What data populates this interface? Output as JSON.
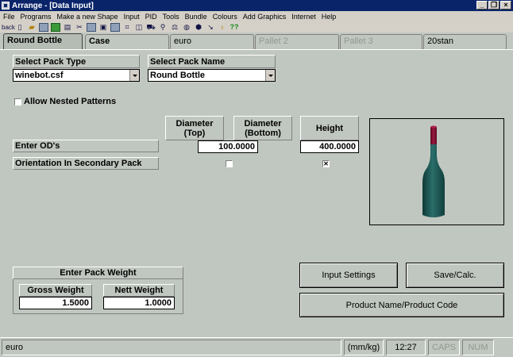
{
  "window": {
    "title": "Arrange - [Data Input]"
  },
  "menu": [
    "File",
    "Programs",
    "Make a new Shape",
    "Input",
    "PID",
    "Tools",
    "Bundle",
    "Colours",
    "Add Graphics",
    "Internet",
    "Help"
  ],
  "toolbar": {
    "back_label": "back",
    "help_label": "??"
  },
  "tabs": [
    {
      "label": "Round Bottle",
      "active": true
    },
    {
      "label": "Case"
    },
    {
      "label": "euro"
    },
    {
      "label": "Pallet 2",
      "disabled": true
    },
    {
      "label": "Pallet 3",
      "disabled": true
    },
    {
      "label": "20stan"
    }
  ],
  "form": {
    "pack_type_label": "Select Pack Type",
    "pack_type_value": "winebot.csf",
    "pack_name_label": "Select Pack Name",
    "pack_name_value": "Round Bottle",
    "nested_label": "Allow Nested Patterns",
    "col_diam_top": "Diameter\n(Top)",
    "col_diam_bottom": "Diameter\n(Bottom)",
    "col_height": "Height",
    "od_label": "Enter OD's",
    "od_diameter": "100.0000",
    "od_height": "400.0000",
    "orientation_label": "Orientation In Secondary Pack",
    "orientation_diameter_checked": false,
    "orientation_height_checked": true,
    "orientation_check_glyph": "✕"
  },
  "weight": {
    "title": "Enter Pack Weight",
    "gross_label": "Gross Weight",
    "gross_value": "1.5000",
    "nett_label": "Nett Weight",
    "nett_value": "1.0000"
  },
  "buttons": {
    "input_settings": "Input Settings",
    "save_calc": "Save/Calc.",
    "product_name": "Product Name/Product Code"
  },
  "status": {
    "pallet": "euro",
    "units": "(mm/kg)",
    "time": "12:27",
    "caps": "CAPS",
    "num": "NUM"
  },
  "colors": {
    "bottle_body": "#1e5a58",
    "bottle_cap": "#7a1430",
    "background": "#c0c7c0"
  }
}
